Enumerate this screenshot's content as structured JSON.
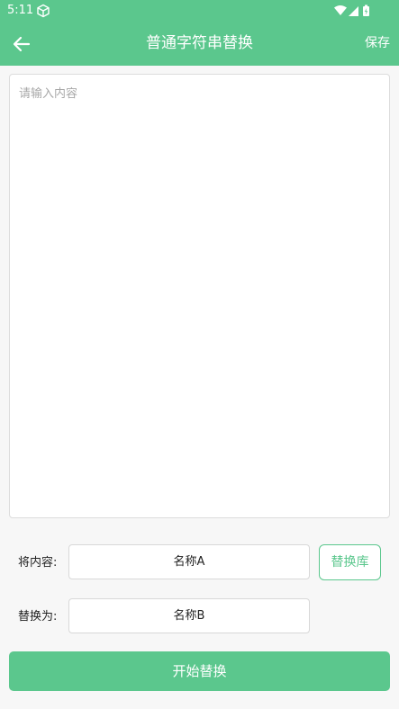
{
  "status_bar": {
    "time": "5:11",
    "icons": [
      "cube-icon",
      "wifi-icon",
      "signal-icon",
      "battery-charging-icon"
    ]
  },
  "app_bar": {
    "back_icon": "arrow-left-icon",
    "title": "普通字符串替换",
    "save_label": "保存"
  },
  "content": {
    "placeholder": "请输入内容",
    "value": ""
  },
  "replace_from": {
    "label": "将内容:",
    "value": "名称A"
  },
  "library_button": {
    "label": "替换库"
  },
  "replace_to": {
    "label": "替换为:",
    "value": "名称B"
  },
  "start_button": {
    "label": "开始替换"
  },
  "colors": {
    "accent": "#5bc78d",
    "background": "#f7f7f7",
    "field_background": "#ffffff",
    "placeholder": "#a8a8a8"
  }
}
